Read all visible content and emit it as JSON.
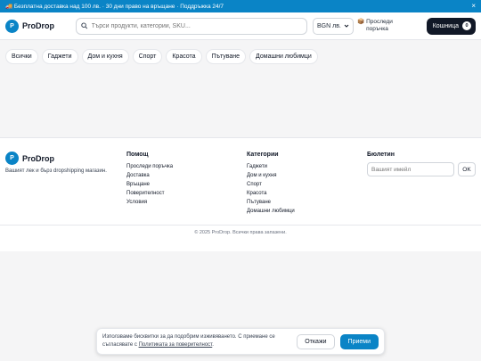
{
  "promo": {
    "text": "🚚 Безплатна доставка над 100 лв. · 30 дни право на връщане · Поддръжка 24/7",
    "close": "×"
  },
  "header": {
    "logo_letter": "P",
    "brand": "ProDrop",
    "search_placeholder": "Търси продукти, категории, SKU...",
    "currency": "BGN лв.",
    "track_order": "Проследи поръчка",
    "track_icon": "📦",
    "cart_label": "Кошница",
    "cart_count": "0"
  },
  "categories": [
    "Всички",
    "Гаджети",
    "Дом и кухня",
    "Спорт",
    "Красота",
    "Пътуване",
    "Домашни любимци"
  ],
  "footer": {
    "brand": "ProDrop",
    "logo_letter": "P",
    "tagline": "Вашият лек и бърз dropshipping магазин.",
    "help": {
      "title": "Помощ",
      "links": [
        "Проследи поръчка",
        "Доставка",
        "Връщане",
        "Поверителност",
        "Условия"
      ]
    },
    "categories": {
      "title": "Категории",
      "links": [
        "Гаджети",
        "Дом и кухня",
        "Спорт",
        "Красота",
        "Пътуване",
        "Домашни любимци"
      ]
    },
    "newsletter": {
      "title": "Бюлетин",
      "placeholder": "Вашият имейл",
      "button": "OK"
    },
    "copyright": "© 2025 ProDrop. Всички права запазени."
  },
  "cookie": {
    "text_before": "Използваме бисквитки за да подобрим изживяването. С приемане се съгласявате с ",
    "link": "Политиката за поверителност",
    "text_after": ".",
    "decline": "Откажи",
    "accept": "Приеми"
  },
  "colors": {
    "accent": "#0a84c6",
    "cart_bg": "#111827"
  }
}
